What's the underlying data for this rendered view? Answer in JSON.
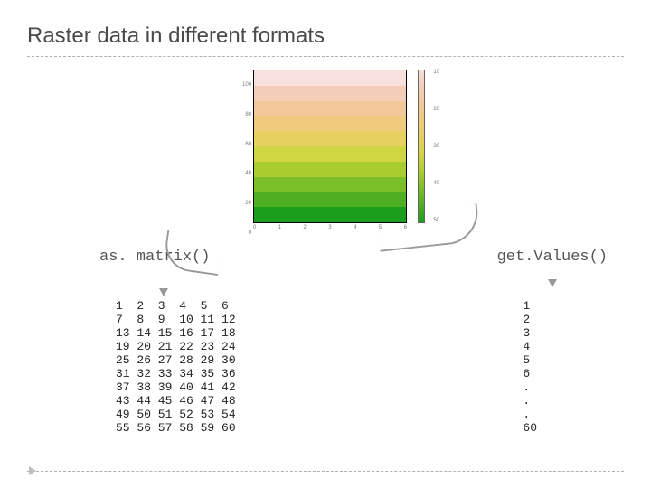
{
  "title": "Raster data in different formats",
  "left_heading": "as. matrix()",
  "right_heading": "get.Values()",
  "plot": {
    "y_ticks": [
      "0",
      "20",
      "40",
      "60",
      "80",
      "100"
    ],
    "x_ticks": [
      "0",
      "1",
      "2",
      "3",
      "4",
      "5",
      "6"
    ],
    "legend_ticks": [
      "10",
      "20",
      "30",
      "40",
      "50"
    ]
  },
  "matrix_text": "1  2  3  4  5  6\n7  8  9  10 11 12\n13 14 15 16 17 18\n19 20 21 22 23 24\n25 26 27 28 29 30\n31 32 33 34 35 36\n37 38 39 40 41 42\n43 44 45 46 47 48\n49 50 51 52 53 54\n55 56 57 58 59 60",
  "vector_text": "1\n2\n3\n4\n5\n6\n.\n.\n.\n60",
  "chart_data": {
    "type": "heatmap",
    "title": "Raster grid",
    "nrows": 10,
    "ncols": 6,
    "values": [
      [
        1,
        2,
        3,
        4,
        5,
        6
      ],
      [
        7,
        8,
        9,
        10,
        11,
        12
      ],
      [
        13,
        14,
        15,
        16,
        17,
        18
      ],
      [
        19,
        20,
        21,
        22,
        23,
        24
      ],
      [
        25,
        26,
        27,
        28,
        29,
        30
      ],
      [
        31,
        32,
        33,
        34,
        35,
        36
      ],
      [
        37,
        38,
        39,
        40,
        41,
        42
      ],
      [
        43,
        44,
        45,
        46,
        47,
        48
      ],
      [
        49,
        50,
        51,
        52,
        53,
        54
      ],
      [
        55,
        56,
        57,
        58,
        59,
        60
      ]
    ],
    "x_range": [
      0,
      6
    ],
    "y_range": [
      0,
      100
    ],
    "colorbar_range": [
      1,
      60
    ],
    "palette": "terrain (pink→yellow→green)"
  }
}
